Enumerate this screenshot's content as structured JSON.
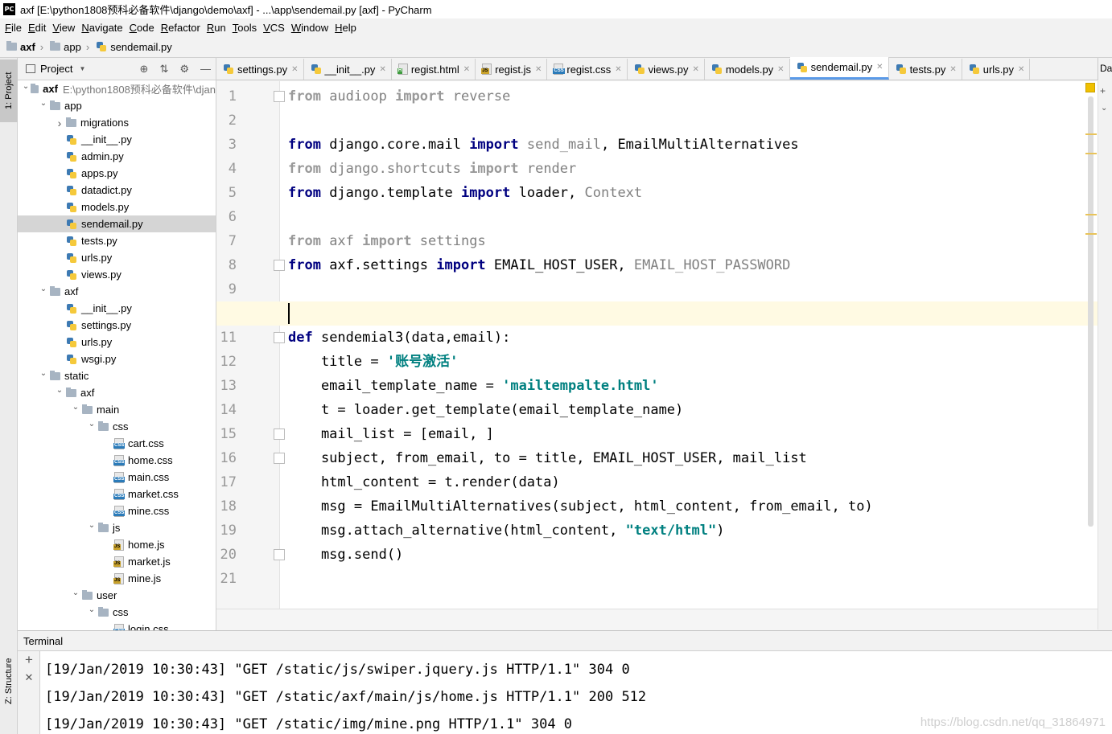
{
  "window": {
    "title": "axf [E:\\python1808预科必备软件\\django\\demo\\axf] - ...\\app\\sendemail.py [axf] - PyCharm",
    "logo_text": "PC"
  },
  "menu": [
    {
      "label": "File",
      "mnemonic": "F",
      "rest": "ile"
    },
    {
      "label": "Edit",
      "mnemonic": "E",
      "rest": "dit"
    },
    {
      "label": "View",
      "mnemonic": "V",
      "rest": "iew"
    },
    {
      "label": "Navigate",
      "mnemonic": "N",
      "rest": "avigate"
    },
    {
      "label": "Code",
      "mnemonic": "C",
      "rest": "ode"
    },
    {
      "label": "Refactor",
      "mnemonic": "R",
      "rest": "efactor"
    },
    {
      "label": "Run",
      "mnemonic": "R",
      "rest": "un"
    },
    {
      "label": "Tools",
      "mnemonic": "T",
      "rest": "ools"
    },
    {
      "label": "VCS",
      "mnemonic": "V",
      "rest": "CS"
    },
    {
      "label": "Window",
      "mnemonic": "W",
      "rest": "indow"
    },
    {
      "label": "Help",
      "mnemonic": "H",
      "rest": "elp"
    }
  ],
  "breadcrumb": [
    "axf",
    "app",
    "sendemail.py"
  ],
  "sidebar": {
    "project_tab": "1: Project",
    "structure_tab": "Z: Structure"
  },
  "project_panel": {
    "title": "Project",
    "tree": [
      {
        "depth": 0,
        "arrow": "open",
        "type": "folder",
        "label": "axf",
        "bold": true,
        "sub": "E:\\python1808预科必备软件\\djan"
      },
      {
        "depth": 1,
        "arrow": "open",
        "type": "folder",
        "label": "app"
      },
      {
        "depth": 2,
        "arrow": "closed",
        "type": "folder",
        "label": "migrations"
      },
      {
        "depth": 2,
        "arrow": "",
        "type": "py",
        "label": "__init__.py"
      },
      {
        "depth": 2,
        "arrow": "",
        "type": "py",
        "label": "admin.py"
      },
      {
        "depth": 2,
        "arrow": "",
        "type": "py",
        "label": "apps.py"
      },
      {
        "depth": 2,
        "arrow": "",
        "type": "py",
        "label": "datadict.py"
      },
      {
        "depth": 2,
        "arrow": "",
        "type": "py",
        "label": "models.py"
      },
      {
        "depth": 2,
        "arrow": "",
        "type": "py",
        "label": "sendemail.py",
        "selected": true
      },
      {
        "depth": 2,
        "arrow": "",
        "type": "py",
        "label": "tests.py"
      },
      {
        "depth": 2,
        "arrow": "",
        "type": "py",
        "label": "urls.py"
      },
      {
        "depth": 2,
        "arrow": "",
        "type": "py",
        "label": "views.py"
      },
      {
        "depth": 1,
        "arrow": "open",
        "type": "folder",
        "label": "axf"
      },
      {
        "depth": 2,
        "arrow": "",
        "type": "py",
        "label": "__init__.py"
      },
      {
        "depth": 2,
        "arrow": "",
        "type": "py",
        "label": "settings.py"
      },
      {
        "depth": 2,
        "arrow": "",
        "type": "py",
        "label": "urls.py"
      },
      {
        "depth": 2,
        "arrow": "",
        "type": "py",
        "label": "wsgi.py"
      },
      {
        "depth": 1,
        "arrow": "open",
        "type": "folder",
        "label": "static"
      },
      {
        "depth": 2,
        "arrow": "open",
        "type": "folder",
        "label": "axf"
      },
      {
        "depth": 3,
        "arrow": "open",
        "type": "folder",
        "label": "main"
      },
      {
        "depth": 4,
        "arrow": "open",
        "type": "folder",
        "label": "css"
      },
      {
        "depth": 5,
        "arrow": "",
        "type": "css",
        "label": "cart.css"
      },
      {
        "depth": 5,
        "arrow": "",
        "type": "css",
        "label": "home.css"
      },
      {
        "depth": 5,
        "arrow": "",
        "type": "css",
        "label": "main.css"
      },
      {
        "depth": 5,
        "arrow": "",
        "type": "css",
        "label": "market.css"
      },
      {
        "depth": 5,
        "arrow": "",
        "type": "css",
        "label": "mine.css"
      },
      {
        "depth": 4,
        "arrow": "open",
        "type": "folder",
        "label": "js"
      },
      {
        "depth": 5,
        "arrow": "",
        "type": "js",
        "label": "home.js"
      },
      {
        "depth": 5,
        "arrow": "",
        "type": "js",
        "label": "market.js"
      },
      {
        "depth": 5,
        "arrow": "",
        "type": "js",
        "label": "mine.js"
      },
      {
        "depth": 3,
        "arrow": "open",
        "type": "folder",
        "label": "user"
      },
      {
        "depth": 4,
        "arrow": "open",
        "type": "folder",
        "label": "css"
      },
      {
        "depth": 5,
        "arrow": "",
        "type": "css",
        "label": "login.css"
      }
    ]
  },
  "tabs": [
    {
      "label": "settings.py",
      "type": "py"
    },
    {
      "label": "__init__.py",
      "type": "py"
    },
    {
      "label": "regist.html",
      "type": "html"
    },
    {
      "label": "regist.js",
      "type": "js"
    },
    {
      "label": "regist.css",
      "type": "css"
    },
    {
      "label": "views.py",
      "type": "py"
    },
    {
      "label": "models.py",
      "type": "py"
    },
    {
      "label": "sendemail.py",
      "type": "py",
      "active": true
    },
    {
      "label": "tests.py",
      "type": "py"
    },
    {
      "label": "urls.py",
      "type": "py"
    }
  ],
  "tab_overflow": "Da",
  "editor": {
    "current_line": 10,
    "lines": [
      {
        "n": "1",
        "tokens": [
          [
            "kw-dim",
            "from"
          ],
          [
            "dim",
            " audioop "
          ],
          [
            "kw-dim",
            "import"
          ],
          [
            "dim",
            " reverse"
          ]
        ]
      },
      {
        "n": "2",
        "tokens": []
      },
      {
        "n": "3",
        "tokens": [
          [
            "kw",
            "from"
          ],
          [
            "",
            " django.core.mail "
          ],
          [
            "kw",
            "import"
          ],
          [
            "dim",
            " send_mail"
          ],
          [
            "",
            ", EmailMultiAlternatives"
          ]
        ]
      },
      {
        "n": "4",
        "tokens": [
          [
            "kw-dim",
            "from"
          ],
          [
            "dim",
            " django.shortcuts "
          ],
          [
            "kw-dim",
            "import"
          ],
          [
            "dim",
            " render"
          ]
        ]
      },
      {
        "n": "5",
        "tokens": [
          [
            "kw",
            "from"
          ],
          [
            "",
            " django.template "
          ],
          [
            "kw",
            "import"
          ],
          [
            "",
            " loader, "
          ],
          [
            "dim",
            "Context"
          ]
        ]
      },
      {
        "n": "6",
        "tokens": []
      },
      {
        "n": "7",
        "tokens": [
          [
            "kw-dim",
            "from"
          ],
          [
            "dim",
            " axf "
          ],
          [
            "kw-dim",
            "import"
          ],
          [
            "dim",
            " settings"
          ]
        ]
      },
      {
        "n": "8",
        "tokens": [
          [
            "kw",
            "from"
          ],
          [
            "",
            " axf.settings "
          ],
          [
            "kw",
            "import"
          ],
          [
            "",
            " EMAIL_HOST_USER, "
          ],
          [
            "dim",
            "EMAIL_HOST_PASSWORD"
          ]
        ]
      },
      {
        "n": "9",
        "tokens": []
      },
      {
        "n": "10",
        "tokens": []
      },
      {
        "n": "11",
        "tokens": [
          [
            "kw",
            "def"
          ],
          [
            "",
            " sendemial3(data,email):"
          ]
        ]
      },
      {
        "n": "12",
        "tokens": [
          [
            "",
            "    title = "
          ],
          [
            "str",
            "'账号激活'"
          ]
        ]
      },
      {
        "n": "13",
        "tokens": [
          [
            "",
            "    email_template_name = "
          ],
          [
            "str",
            "'mailtempalte.html'"
          ]
        ]
      },
      {
        "n": "14",
        "tokens": [
          [
            "",
            "    t = loader.get_template(email_template_name)"
          ]
        ]
      },
      {
        "n": "15",
        "tokens": [
          [
            "",
            "    mail_list = [email, ]"
          ]
        ]
      },
      {
        "n": "16",
        "tokens": [
          [
            "",
            "    subject, from_email, to = title, EMAIL_HOST_USER, mail_list"
          ]
        ]
      },
      {
        "n": "17",
        "tokens": [
          [
            "",
            "    html_content = t.render(data)"
          ]
        ]
      },
      {
        "n": "18",
        "tokens": [
          [
            "",
            "    msg = EmailMultiAlternatives(subject, html_content, from_email, to)"
          ]
        ]
      },
      {
        "n": "19",
        "tokens": [
          [
            "",
            "    msg.attach_alternative(html_content, "
          ],
          [
            "str",
            "\"text/html\""
          ],
          [
            "",
            ")"
          ]
        ]
      },
      {
        "n": "20",
        "tokens": [
          [
            "",
            "    msg.send()"
          ]
        ]
      },
      {
        "n": "21",
        "tokens": []
      }
    ]
  },
  "terminal": {
    "title": "Terminal",
    "add_label": "+",
    "close_label": "✕",
    "lines": [
      "[19/Jan/2019 10:30:43] \"GET /static/js/swiper.jquery.js HTTP/1.1\" 304 0",
      "[19/Jan/2019 10:30:43] \"GET /static/axf/main/js/home.js HTTP/1.1\" 200 512",
      "[19/Jan/2019 10:30:43] \"GET /static/img/mine.png HTTP/1.1\" 304 0"
    ],
    "watermark": "https://blog.csdn.net/qq_31864971"
  },
  "colors": {
    "keyword": "#000080",
    "string": "#008080",
    "dim": "#808080",
    "current_line": "#fffae3",
    "selection": "#d5d5d5",
    "active_tab_underline": "#5a9ae8"
  }
}
